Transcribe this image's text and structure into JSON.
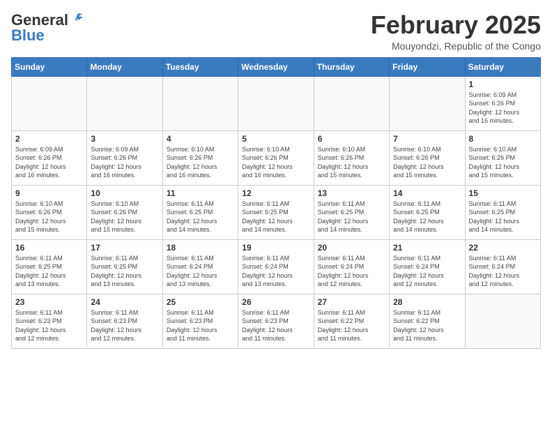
{
  "header": {
    "logo_general": "General",
    "logo_blue": "Blue",
    "month_year": "February 2025",
    "location": "Mouyondzi, Republic of the Congo"
  },
  "weekdays": [
    "Sunday",
    "Monday",
    "Tuesday",
    "Wednesday",
    "Thursday",
    "Friday",
    "Saturday"
  ],
  "weeks": [
    [
      {
        "day": "",
        "info": ""
      },
      {
        "day": "",
        "info": ""
      },
      {
        "day": "",
        "info": ""
      },
      {
        "day": "",
        "info": ""
      },
      {
        "day": "",
        "info": ""
      },
      {
        "day": "",
        "info": ""
      },
      {
        "day": "1",
        "info": "Sunrise: 6:09 AM\nSunset: 6:26 PM\nDaylight: 12 hours\nand 16 minutes."
      }
    ],
    [
      {
        "day": "2",
        "info": "Sunrise: 6:09 AM\nSunset: 6:26 PM\nDaylight: 12 hours\nand 16 minutes."
      },
      {
        "day": "3",
        "info": "Sunrise: 6:09 AM\nSunset: 6:26 PM\nDaylight: 12 hours\nand 16 minutes."
      },
      {
        "day": "4",
        "info": "Sunrise: 6:10 AM\nSunset: 6:26 PM\nDaylight: 12 hours\nand 16 minutes."
      },
      {
        "day": "5",
        "info": "Sunrise: 6:10 AM\nSunset: 6:26 PM\nDaylight: 12 hours\nand 16 minutes."
      },
      {
        "day": "6",
        "info": "Sunrise: 6:10 AM\nSunset: 6:26 PM\nDaylight: 12 hours\nand 15 minutes."
      },
      {
        "day": "7",
        "info": "Sunrise: 6:10 AM\nSunset: 6:26 PM\nDaylight: 12 hours\nand 15 minutes."
      },
      {
        "day": "8",
        "info": "Sunrise: 6:10 AM\nSunset: 6:26 PM\nDaylight: 12 hours\nand 15 minutes."
      }
    ],
    [
      {
        "day": "9",
        "info": "Sunrise: 6:10 AM\nSunset: 6:26 PM\nDaylight: 12 hours\nand 15 minutes."
      },
      {
        "day": "10",
        "info": "Sunrise: 6:10 AM\nSunset: 6:26 PM\nDaylight: 12 hours\nand 15 minutes."
      },
      {
        "day": "11",
        "info": "Sunrise: 6:11 AM\nSunset: 6:25 PM\nDaylight: 12 hours\nand 14 minutes."
      },
      {
        "day": "12",
        "info": "Sunrise: 6:11 AM\nSunset: 6:25 PM\nDaylight: 12 hours\nand 14 minutes."
      },
      {
        "day": "13",
        "info": "Sunrise: 6:11 AM\nSunset: 6:25 PM\nDaylight: 12 hours\nand 14 minutes."
      },
      {
        "day": "14",
        "info": "Sunrise: 6:11 AM\nSunset: 6:25 PM\nDaylight: 12 hours\nand 14 minutes."
      },
      {
        "day": "15",
        "info": "Sunrise: 6:11 AM\nSunset: 6:25 PM\nDaylight: 12 hours\nand 14 minutes."
      }
    ],
    [
      {
        "day": "16",
        "info": "Sunrise: 6:11 AM\nSunset: 6:25 PM\nDaylight: 12 hours\nand 13 minutes."
      },
      {
        "day": "17",
        "info": "Sunrise: 6:11 AM\nSunset: 6:25 PM\nDaylight: 12 hours\nand 13 minutes."
      },
      {
        "day": "18",
        "info": "Sunrise: 6:11 AM\nSunset: 6:24 PM\nDaylight: 12 hours\nand 13 minutes."
      },
      {
        "day": "19",
        "info": "Sunrise: 6:11 AM\nSunset: 6:24 PM\nDaylight: 12 hours\nand 13 minutes."
      },
      {
        "day": "20",
        "info": "Sunrise: 6:11 AM\nSunset: 6:24 PM\nDaylight: 12 hours\nand 12 minutes."
      },
      {
        "day": "21",
        "info": "Sunrise: 6:11 AM\nSunset: 6:24 PM\nDaylight: 12 hours\nand 12 minutes."
      },
      {
        "day": "22",
        "info": "Sunrise: 6:11 AM\nSunset: 6:24 PM\nDaylight: 12 hours\nand 12 minutes."
      }
    ],
    [
      {
        "day": "23",
        "info": "Sunrise: 6:11 AM\nSunset: 6:23 PM\nDaylight: 12 hours\nand 12 minutes."
      },
      {
        "day": "24",
        "info": "Sunrise: 6:11 AM\nSunset: 6:23 PM\nDaylight: 12 hours\nand 12 minutes."
      },
      {
        "day": "25",
        "info": "Sunrise: 6:11 AM\nSunset: 6:23 PM\nDaylight: 12 hours\nand 11 minutes."
      },
      {
        "day": "26",
        "info": "Sunrise: 6:11 AM\nSunset: 6:23 PM\nDaylight: 12 hours\nand 11 minutes."
      },
      {
        "day": "27",
        "info": "Sunrise: 6:11 AM\nSunset: 6:22 PM\nDaylight: 12 hours\nand 11 minutes."
      },
      {
        "day": "28",
        "info": "Sunrise: 6:11 AM\nSunset: 6:22 PM\nDaylight: 12 hours\nand 11 minutes."
      },
      {
        "day": "",
        "info": ""
      }
    ]
  ]
}
